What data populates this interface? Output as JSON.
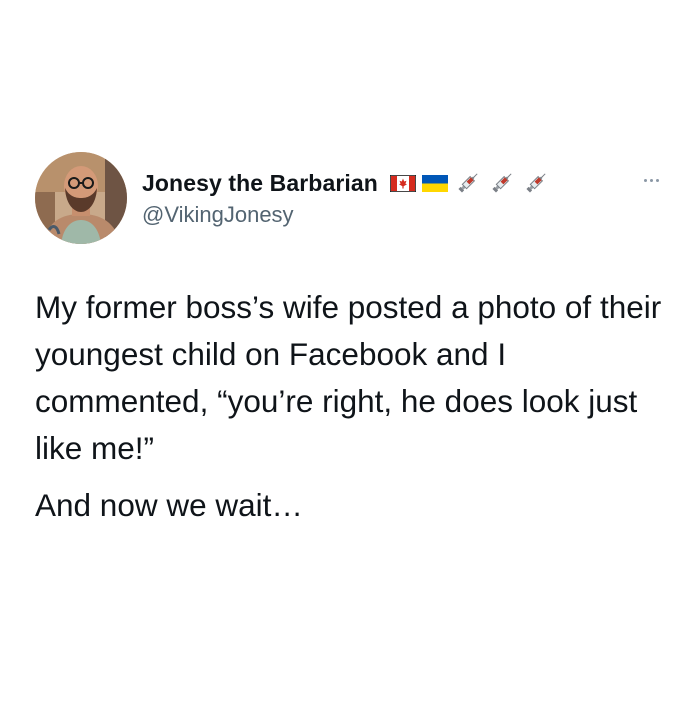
{
  "tweet": {
    "author": {
      "display_name": "Jonesy the Barbarian",
      "handle": "@VikingJonesy",
      "name_badges": [
        "canada-flag-icon",
        "ukraine-flag-icon",
        "syringe-icon",
        "syringe-icon",
        "syringe-icon"
      ]
    },
    "more_icon": "ellipsis-icon",
    "text_paragraph_1": "My former boss’s wife posted a photo of their youngest child on Facebook and I commented, “you’re right, he does look just like me!”",
    "text_paragraph_2": "And now we wait…"
  },
  "colors": {
    "text_primary": "#0f1419",
    "text_secondary": "#536471",
    "canada_red": "#d52b1e",
    "ukraine_blue": "#0057b7",
    "ukraine_yellow": "#ffd700"
  }
}
